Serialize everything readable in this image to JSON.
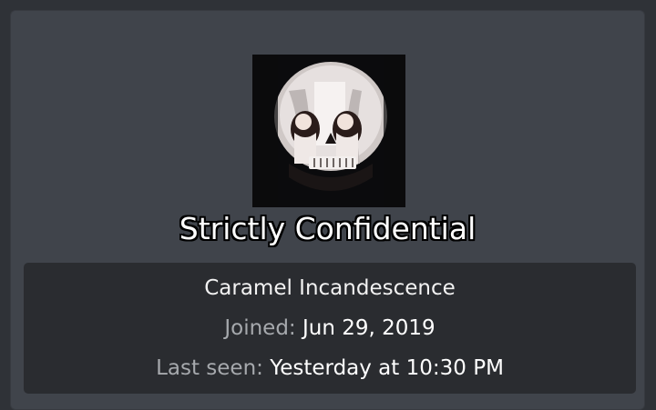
{
  "profile": {
    "username": "Strictly Confidential",
    "user_title": "Caramel Incandescence",
    "joined_label": "Joined:",
    "joined_value": "Jun 29, 2019",
    "last_seen_label": "Last seen:",
    "last_seen_value": "Yesterday at 10:30 PM",
    "avatar_icon": "avatar-skull-illusion"
  },
  "colors": {
    "page_bg": "#2f3237",
    "card_bg": "#40444b",
    "panel_bg": "#2a2c30",
    "label_muted": "#a6a9ad",
    "text": "#ffffff"
  }
}
